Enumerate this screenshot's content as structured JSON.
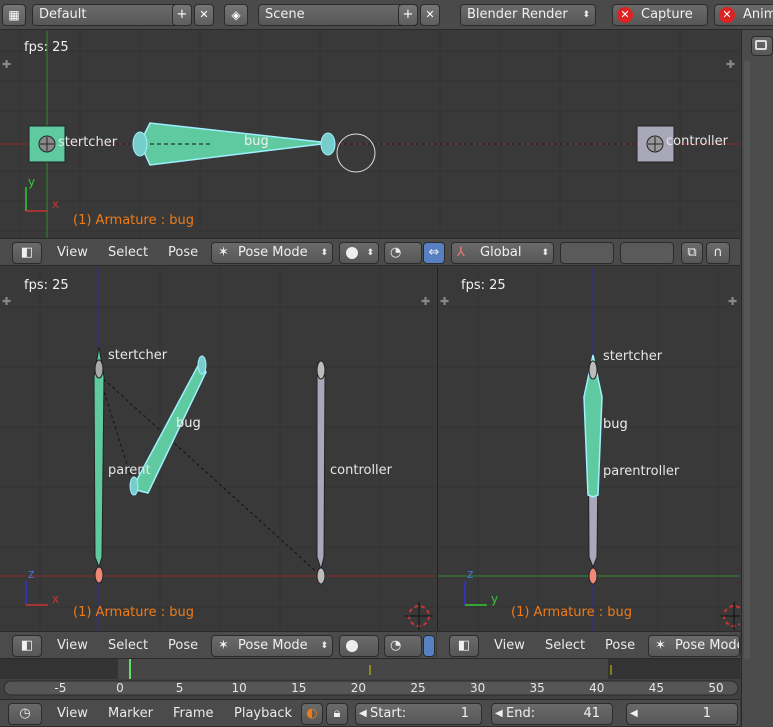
{
  "top_bar": {
    "layout_value": "Default",
    "scene_value": "Scene",
    "engine_value": "Blender Render",
    "capture_label": "Capture",
    "anim_label": "Anim",
    "plus": "+",
    "close": "✕"
  },
  "viewport_top": {
    "fps": "fps: 25",
    "object_info": "(1) Armature : bug",
    "labels": {
      "stretcher": "stertcher",
      "bug": "bug",
      "controller": "controller"
    }
  },
  "header_top": {
    "menu_view": "View",
    "menu_select": "Select",
    "menu_pose": "Pose",
    "mode_value": "Pose Mode",
    "orientation_value": "Global"
  },
  "viewport_left": {
    "fps": "fps: 25",
    "object_info": "(1) Armature : bug",
    "labels": {
      "stretcher": "stertcher",
      "bug": "bug",
      "parent": "parent",
      "controller": "controller"
    }
  },
  "viewport_right": {
    "fps": "fps: 25",
    "object_info": "(1) Armature : bug",
    "labels": {
      "stretcher": "stertcher",
      "bug": "bug",
      "parent_controller": "parentroller"
    }
  },
  "header_left": {
    "menu_view": "View",
    "menu_select": "Select",
    "menu_pose": "Pose",
    "mode_value": "Pose Mode"
  },
  "header_right": {
    "menu_view": "View",
    "menu_select": "Select",
    "menu_pose": "Pose",
    "mode_value": "Pose Mode"
  },
  "timeline": {
    "ticks": [
      "-5",
      "0",
      "5",
      "10",
      "15",
      "20",
      "25",
      "30",
      "35",
      "40",
      "45",
      "50"
    ],
    "current_frame": 1,
    "menu_view": "View",
    "menu_marker": "Marker",
    "menu_frame": "Frame",
    "menu_playback": "Playback",
    "start_label": "Start:",
    "start_value": "1",
    "end_label": "End:",
    "end_value": "41",
    "frame_value": "1"
  },
  "colors": {
    "selected_bone": "#5fcaa0",
    "bone_outline": "#a0f0ff",
    "gray_bone": "#a8a8b0",
    "orange_text": "#f07b17",
    "axis_x": "#c83232",
    "axis_y": "#32c832",
    "axis_z": "#3232d8"
  }
}
